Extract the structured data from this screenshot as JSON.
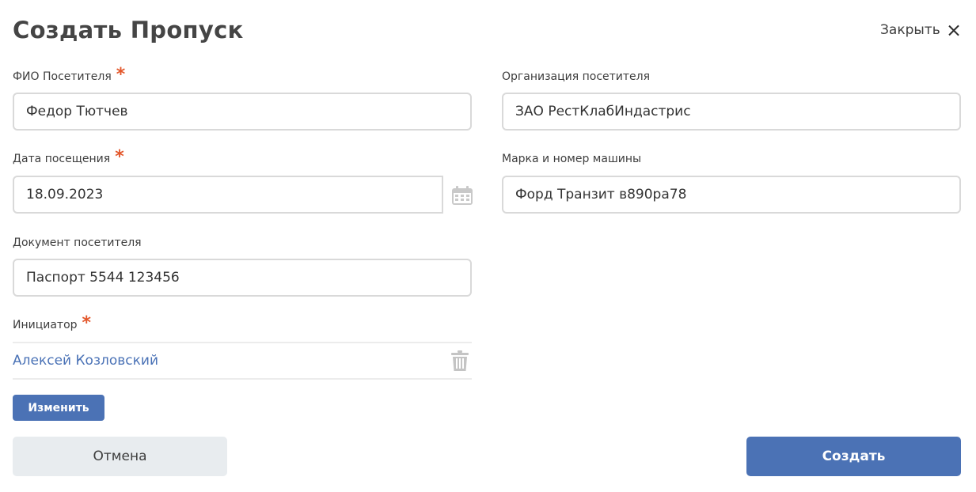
{
  "title": "Создать Пропуск",
  "close_label": "Закрыть",
  "fields": {
    "visitor_name": {
      "label": "ФИО Посетителя",
      "required_mark": "*",
      "value": "Федор Тютчев"
    },
    "organization": {
      "label": "Организация посетителя",
      "value": "ЗАО РестКлабИндастрис"
    },
    "visit_date": {
      "label": "Дата посещения",
      "required_mark": "*",
      "value": "18.09.2023"
    },
    "car": {
      "label": "Марка и номер машины",
      "value": "Форд Транзит в890ра78"
    },
    "document": {
      "label": "Документ посетителя",
      "value": "Паспорт 5544 123456"
    },
    "initiator": {
      "label": "Инициатор",
      "required_mark": "*",
      "value": "Алексей Козловский"
    }
  },
  "buttons": {
    "change": "Изменить",
    "cancel": "Отмена",
    "create": "Создать"
  },
  "icons": {
    "close": "close-icon",
    "calendar": "calendar-icon",
    "trash": "trash-icon"
  },
  "colors": {
    "accent": "#4b72b5",
    "required": "#e3572b",
    "link": "#4a72b6",
    "cancel_bg": "#e8ecef"
  }
}
